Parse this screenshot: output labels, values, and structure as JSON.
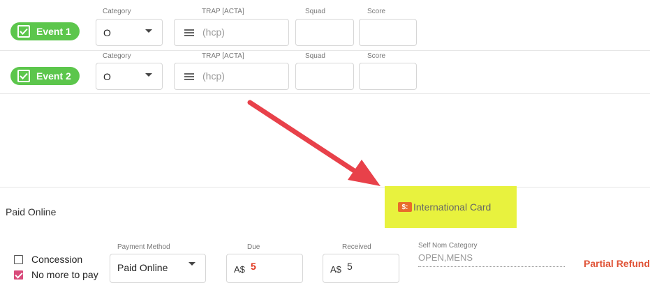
{
  "events": [
    {
      "label": "Event 1",
      "category_label": "Category",
      "category_value": "O",
      "trap_label": "TRAP [ACTA]",
      "hcp_placeholder": "(hcp)",
      "squad_label": "Squad",
      "score_label": "Score"
    },
    {
      "label": "Event 2",
      "category_label": "Category",
      "category_value": "O",
      "trap_label": "TRAP [ACTA]",
      "hcp_placeholder": "(hcp)",
      "squad_label": "Squad",
      "score_label": "Score"
    }
  ],
  "payment": {
    "status_text": "Paid Online",
    "card_icon": "$:",
    "card_text": "International Card",
    "concession_label": "Concession",
    "no_more_to_pay_label": "No more to pay",
    "no_more_to_pay_checked": true,
    "concession_checked": false,
    "method_label": "Payment Method",
    "method_value": "Paid Online",
    "due_label": "Due",
    "due_currency": "A$",
    "due_value": "5",
    "received_label": "Received",
    "received_currency": "A$",
    "received_value": "5",
    "self_nom_label": "Self Nom Category",
    "self_nom_value": "OPEN,MENS",
    "partial_refund_label": "Partial Refund"
  },
  "colors": {
    "event_green": "#5cc64c",
    "highlight_yellow": "#e8f23e",
    "arrow_red": "#e8414a",
    "due_red": "#e0341c",
    "refund_red": "#e05438",
    "checkbox_pink": "#d94b7b"
  }
}
